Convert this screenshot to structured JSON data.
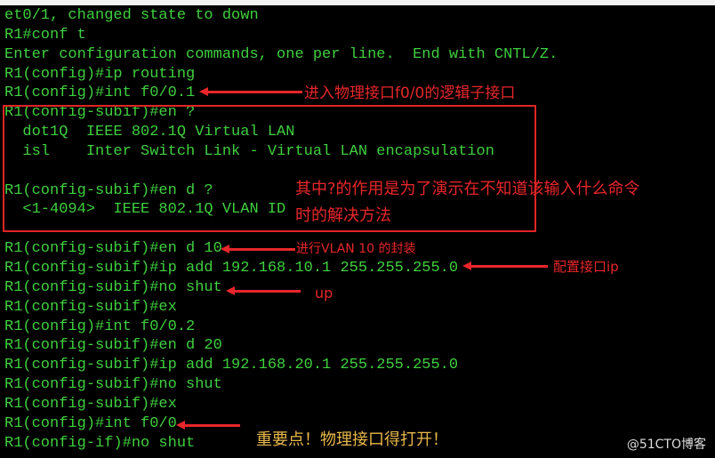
{
  "terminal": {
    "lines": [
      "et0/1, changed state to down",
      "R1#conf t",
      "Enter configuration commands, one per line.  End with CNTL/Z.",
      "R1(config)#ip routing",
      "R1(config)#int f0/0.1",
      "R1(config-subif)#en ?",
      "  dot1Q  IEEE 802.1Q Virtual LAN",
      "  isl    Inter Switch Link - Virtual LAN encapsulation",
      "",
      "R1(config-subif)#en d ?",
      "  <1-4094>  IEEE 802.1Q VLAN ID",
      "",
      "R1(config-subif)#en d 10",
      "R1(config-subif)#ip add 192.168.10.1 255.255.255.0",
      "R1(config-subif)#no shut",
      "R1(config-subif)#ex",
      "R1(config)#int f0/0.2",
      "R1(config-subif)#en d 20",
      "R1(config-subif)#ip add 192.168.20.1 255.255.255.0",
      "R1(config-subif)#no shut",
      "R1(config-subif)#ex",
      "R1(config)#int f0/0",
      "R1(config-if)#no shut"
    ]
  },
  "annotations": {
    "subinterface": "进入物理接口f0/0的逻辑子接口",
    "question_1": "其中?的作用是为了演示在不知道该输入什么命令",
    "question_2": "时的解决方法",
    "encap": "进行VLAN 10 的封装",
    "ip": "配置接口ip",
    "up": "up",
    "important": "重要点！物理接口得打开！"
  },
  "watermark": "@51CTO博客",
  "colors": {
    "text": "#3fcf3f",
    "annotation": "#e8262a",
    "important": "#e8b84a"
  }
}
